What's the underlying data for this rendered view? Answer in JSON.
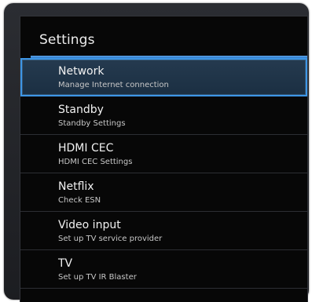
{
  "settings": {
    "title": "Settings",
    "items": [
      {
        "title": "Network",
        "subtitle": "Manage Internet connection",
        "selected": true
      },
      {
        "title": "Standby",
        "subtitle": "Standby Settings",
        "selected": false
      },
      {
        "title": "HDMI CEC",
        "subtitle": "HDMI CEC Settings",
        "selected": false
      },
      {
        "title": "Netflix",
        "subtitle": "Check ESN",
        "selected": false
      },
      {
        "title": "Video input",
        "subtitle": "Set up TV service provider",
        "selected": false
      },
      {
        "title": "TV",
        "subtitle": "Set up TV IR Blaster",
        "selected": false
      }
    ]
  },
  "colors": {
    "accent": "#3d96e6",
    "panel_background": "#070707",
    "frame_background": "#25272c",
    "text_primary": "#f1f1f1",
    "text_secondary": "#c7c7c7"
  }
}
